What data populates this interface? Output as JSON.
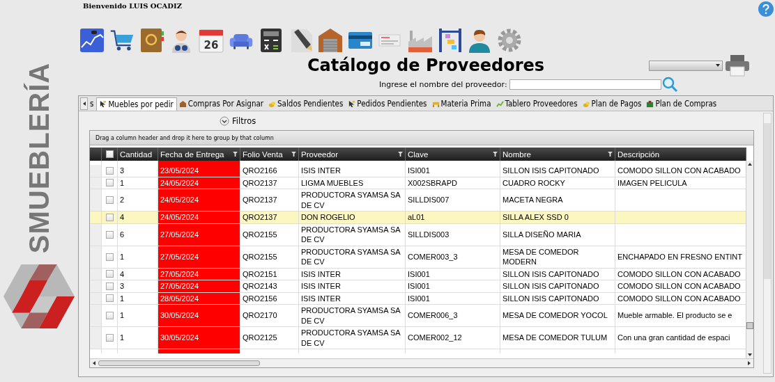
{
  "welcome": "Bienvenido LUIS OCADIZ",
  "logo": {
    "text": "SMUEBLERÍA"
  },
  "toolbar": {
    "calendar_day": "26"
  },
  "title": "Catálogo de Proveedores",
  "search": {
    "label": "Ingrese el nombre del proveedor:"
  },
  "tabs": [
    {
      "label": "s",
      "kind": "none",
      "selected": false
    },
    {
      "label": "Muebles por pedir",
      "kind": "pointer",
      "selected": true
    },
    {
      "label": "Compras Por Asignar",
      "kind": "house",
      "selected": false
    },
    {
      "label": "Saldos Pendientes",
      "kind": "coins",
      "selected": false
    },
    {
      "label": "Pedidos Pendientes",
      "kind": "pointer",
      "selected": false
    },
    {
      "label": "Materia Prima",
      "kind": "bench",
      "selected": false
    },
    {
      "label": "Tablero Proveedores",
      "kind": "chart",
      "selected": false
    },
    {
      "label": "Plan de Pagos",
      "kind": "coins",
      "selected": false
    },
    {
      "label": "Plan de Compras",
      "kind": "box",
      "selected": false
    }
  ],
  "filters_label": "Filtros",
  "group_hint": "Drag a column header and drop it here to group by that column",
  "table": {
    "all_checked": false,
    "columns": [
      {
        "label": "Cantidad",
        "filter": false
      },
      {
        "label": "Fecha de Entrega",
        "filter": true
      },
      {
        "label": "Folio Venta",
        "filter": true
      },
      {
        "label": "Proveedor",
        "filter": true
      },
      {
        "label": "Clave",
        "filter": true
      },
      {
        "label": "Nombre",
        "filter": true
      },
      {
        "label": "Descripción",
        "filter": false
      }
    ],
    "rows": [
      {
        "checked": false,
        "selected": false,
        "late": true,
        "cells": [
          "3",
          "23/05/2024",
          "QRO2166",
          "ISIS INTER",
          "ISI001",
          "SILLON ISIS CAPITONADO",
          "COMODO SILLON CON ACABADO"
        ]
      },
      {
        "checked": false,
        "selected": false,
        "late": true,
        "cells": [
          "1",
          "24/05/2024",
          "QRO2137",
          "LIGMA MUEBLES",
          "X002SBRAPD",
          "CUADRO ROCKY",
          "IMAGEN PELICULA"
        ]
      },
      {
        "checked": false,
        "selected": false,
        "late": true,
        "cells": [
          "2",
          "24/05/2024",
          "QRO2137",
          "PRODUCTORA SYAMSA SA DE CV",
          "SILLDIS007",
          "MACETA NEGRA",
          ""
        ]
      },
      {
        "checked": false,
        "selected": true,
        "late": true,
        "cells": [
          "4",
          "24/05/2024",
          "QRO2137",
          "DON ROGELIO",
          "aL01",
          "SILLA ALEX SSD 0",
          ""
        ]
      },
      {
        "checked": false,
        "selected": false,
        "late": true,
        "cells": [
          "6",
          "27/05/2024",
          "QRO2155",
          "PRODUCTORA SYAMSA SA DE CV",
          "SILLDIS003",
          "SILLA DISEÑO MARIA",
          ""
        ]
      },
      {
        "checked": false,
        "selected": false,
        "late": true,
        "cells": [
          "1",
          "27/05/2024",
          "QRO2155",
          "PRODUCTORA SYAMSA SA DE CV",
          "COMER003_3",
          "MESA DE COMEDOR MODERN",
          "ENCHAPADO EN FRESNO ENTINT"
        ]
      },
      {
        "checked": false,
        "selected": false,
        "late": true,
        "cells": [
          "4",
          "27/05/2024",
          "QRO2151",
          "ISIS INTER",
          "ISI001",
          "SILLON ISIS CAPITONADO",
          "COMODO SILLON CON ACABADO"
        ]
      },
      {
        "checked": false,
        "selected": false,
        "late": true,
        "cells": [
          "3",
          "27/05/2024",
          "QRO2143",
          "ISIS INTER",
          "ISI001",
          "SILLON ISIS CAPITONADO",
          "COMODO SILLON CON ACABADO"
        ]
      },
      {
        "checked": false,
        "selected": false,
        "late": true,
        "cells": [
          "1",
          "28/05/2024",
          "QRO2156",
          "ISIS INTER",
          "ISI001",
          "SILLON ISIS CAPITONADO",
          "COMODO SILLON CON ACABADO"
        ]
      },
      {
        "checked": false,
        "selected": false,
        "late": true,
        "cells": [
          "1",
          "30/05/2024",
          "QRO2170",
          "PRODUCTORA SYAMSA SA DE CV",
          "COMER006_3",
          "MESA DE COMEDOR YOCOL",
          "Mueble armable. El producto se e"
        ]
      },
      {
        "checked": false,
        "selected": false,
        "late": true,
        "cells": [
          "1",
          "30/05/2024",
          "QRO2125",
          "PRODUCTORA SYAMSA SA DE CV",
          "COMER002_12",
          "MESA DE COMEDOR TULUM",
          "Con una gran cantidad de espaci"
        ]
      }
    ]
  }
}
